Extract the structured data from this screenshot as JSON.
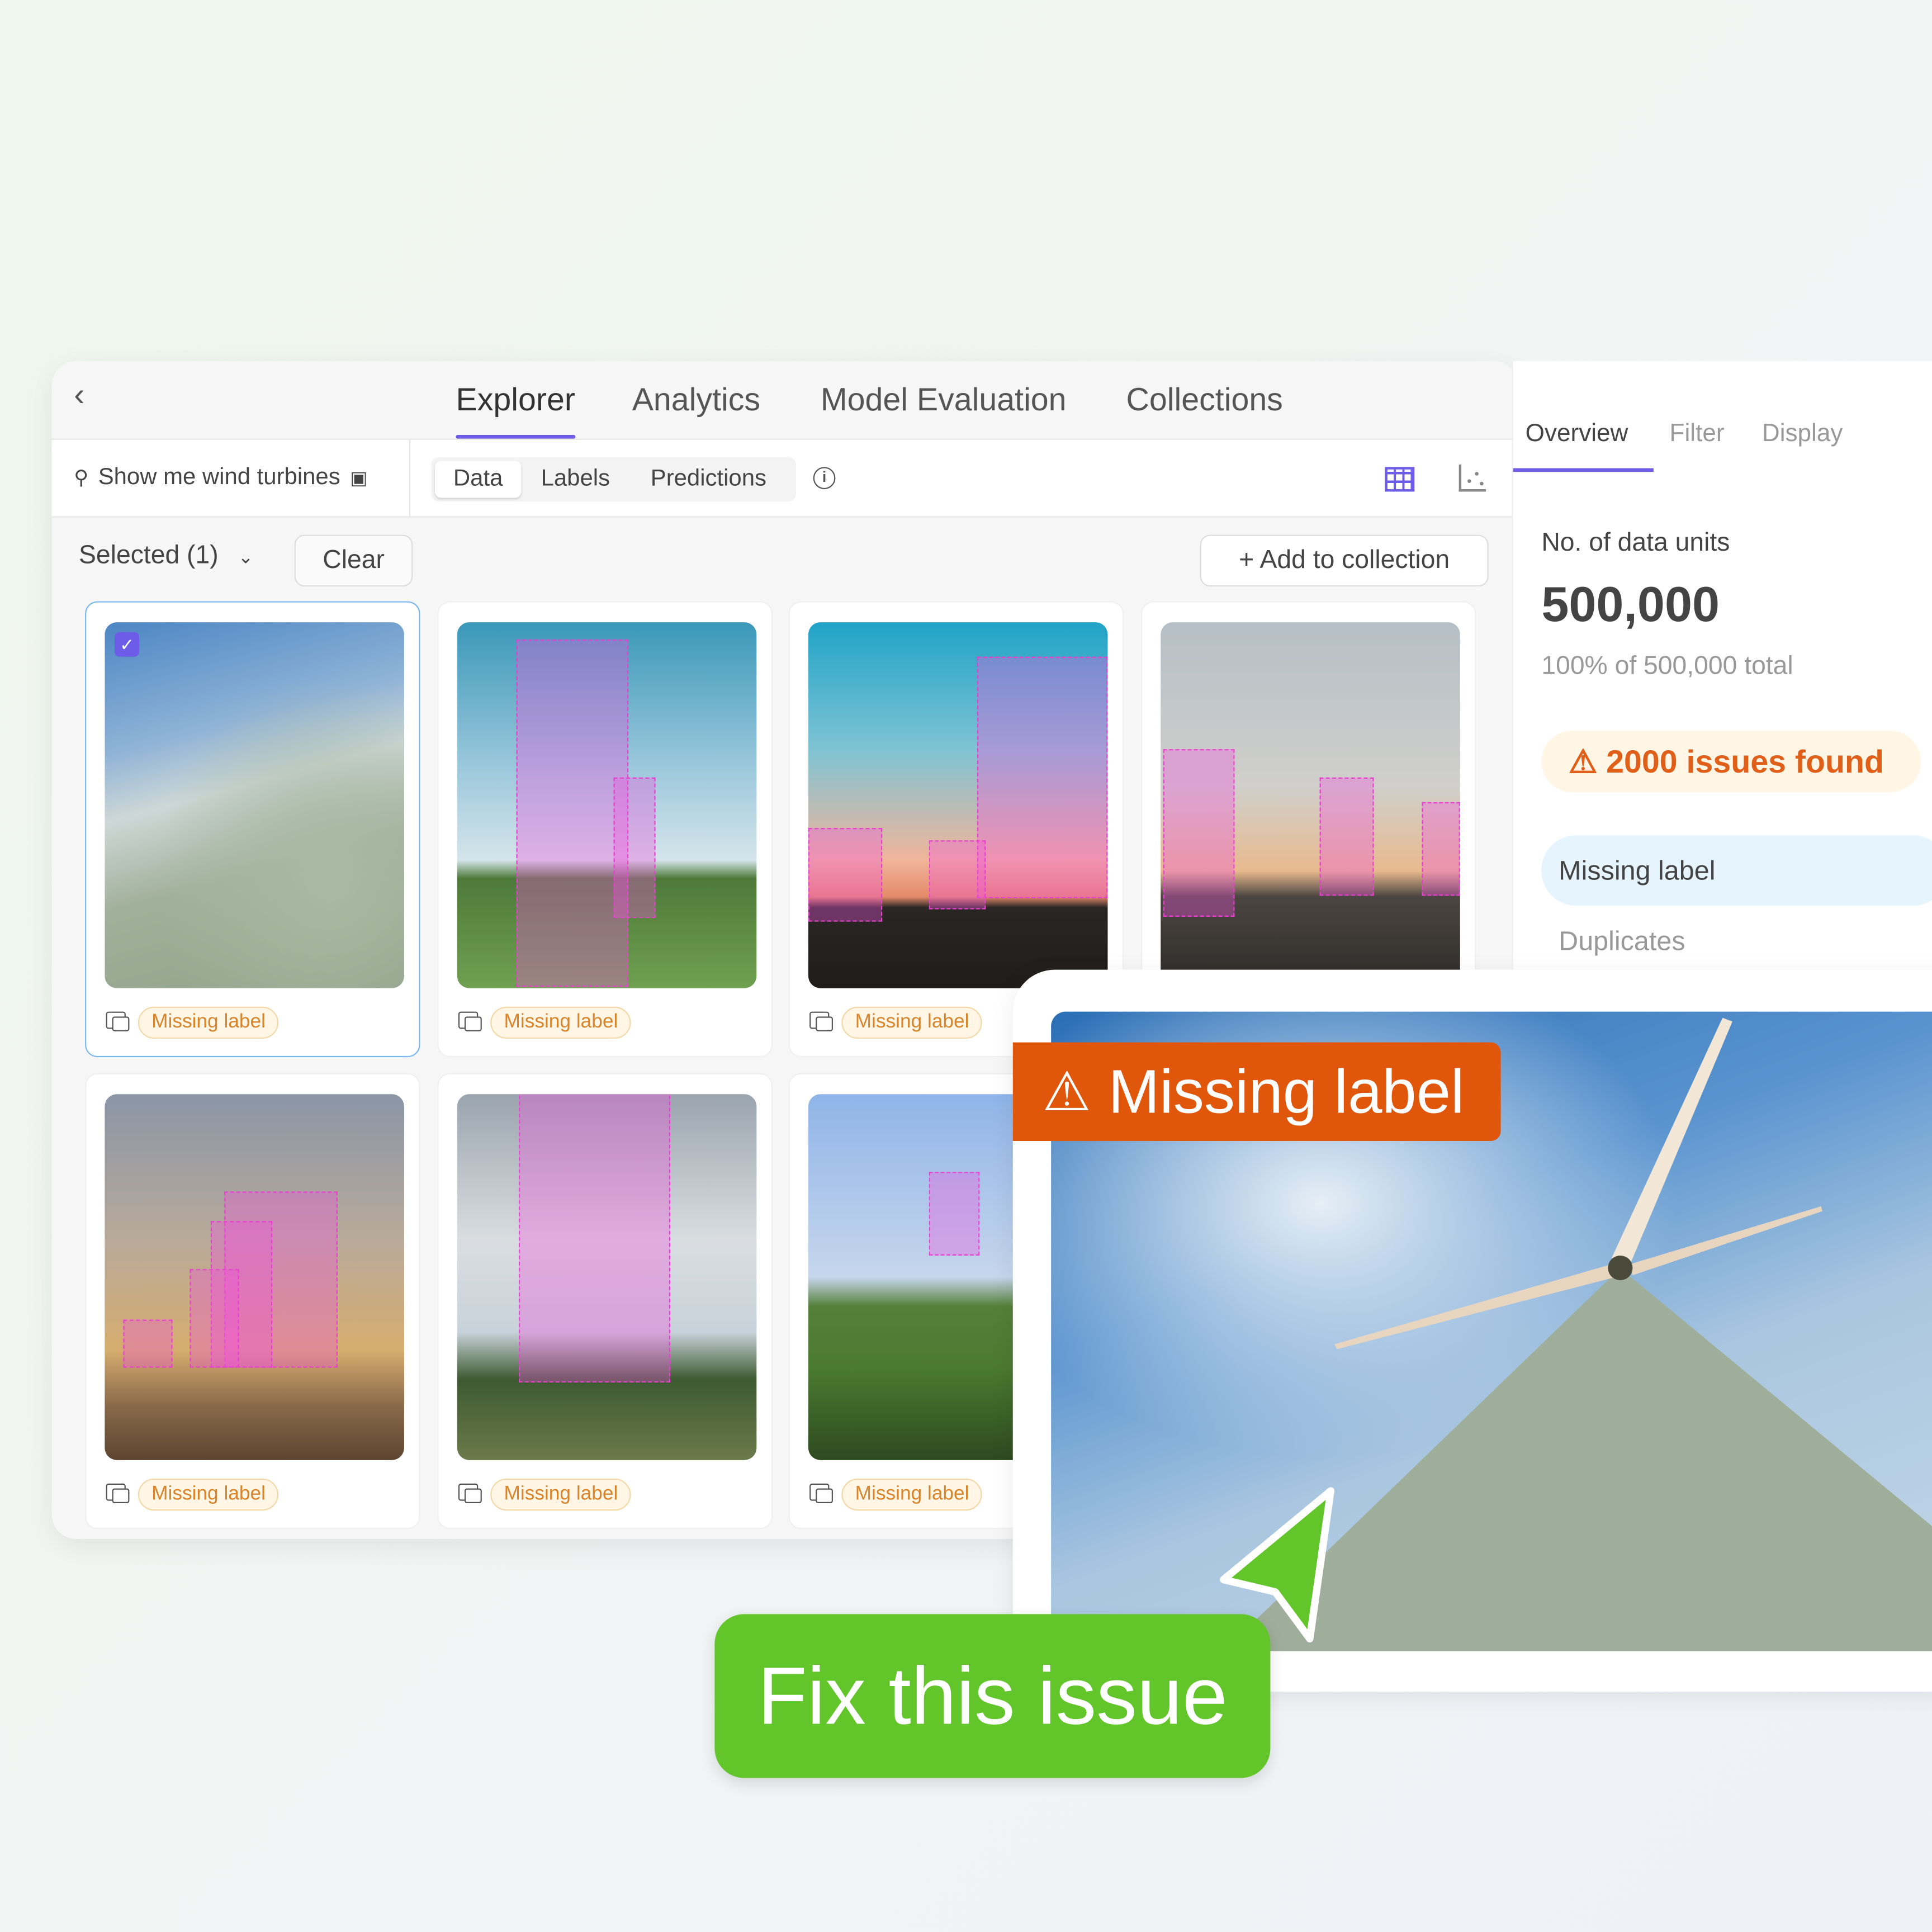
{
  "nav": {
    "back_icon": "chevron-left-icon",
    "tabs": [
      "Explorer",
      "Analytics",
      "Model Evaluation",
      "Collections"
    ],
    "active": "Explorer"
  },
  "toolbar": {
    "search_query": "Show me wind turbines",
    "segments": [
      "Data",
      "Labels",
      "Predictions"
    ],
    "active_segment": "Data"
  },
  "selection": {
    "selected_label": "Selected (1)",
    "clear": "Clear",
    "add_to_collection": "+ Add to collection"
  },
  "cards": [
    {
      "badge": "Missing label",
      "selected": true
    },
    {
      "badge": "Missing label"
    },
    {
      "badge": "Missing label"
    },
    {
      "badge": ""
    },
    {
      "badge": "Missing label"
    },
    {
      "badge": "Missing label"
    },
    {
      "badge": "Missing label"
    }
  ],
  "right_panel": {
    "tabs": [
      "Overview",
      "Filter",
      "Display"
    ],
    "metric_label": "No. of data units",
    "metric_value": "500,000",
    "metric_sub": "100% of 500,000 total",
    "issues": "2000 issues found",
    "issue_types": [
      "Missing label",
      "Duplicates"
    ]
  },
  "preview": {
    "banner": "Missing label"
  },
  "cta": {
    "label": "Fix this issue"
  },
  "colors": {
    "accent": "#6c5ce7",
    "warning": "#e0560a",
    "cta": "#62c52a"
  }
}
